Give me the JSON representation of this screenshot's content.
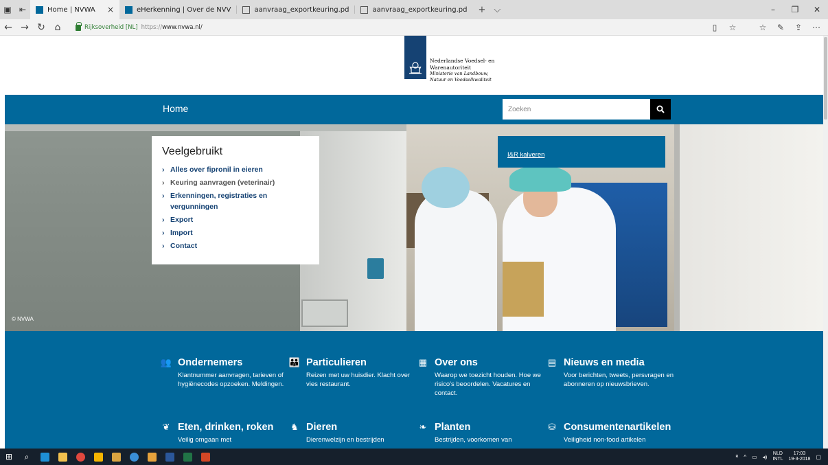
{
  "browser": {
    "tabs": [
      {
        "title": "Home | NVWA",
        "icon": "nvwa-favicon",
        "active": true
      },
      {
        "title": "eHerkenning | Over de NVV",
        "icon": "nvwa-favicon",
        "active": false
      },
      {
        "title": "aanvraag_exportkeuring.pd",
        "icon": "pdf-icon",
        "active": false
      },
      {
        "title": "aanvraag_exportkeuring.pd",
        "icon": "pdf-icon",
        "active": false
      }
    ],
    "address": {
      "org": "Rijksoverheid [NL]",
      "protocol": "https://",
      "host": "www.nvwa.nl/"
    }
  },
  "header": {
    "org_line1": "Nederlandse Voedsel- en",
    "org_line2": "Warenautoriteit",
    "ministry_line1": "Ministerie van Landbouw,",
    "ministry_line2": "Natuur en Voedselkwaliteit"
  },
  "nav": {
    "home": "Home",
    "search_placeholder": "Zoeken"
  },
  "hero": {
    "copyright": "© NVWA",
    "veelgebruikt": {
      "title": "Veelgebruikt",
      "items": [
        {
          "label": "Alles over fipronil in eieren"
        },
        {
          "label": "Keuring aanvragen (veterinair)"
        },
        {
          "label": "Erkenningen, registraties en vergunningen"
        },
        {
          "label": "Export"
        },
        {
          "label": "Import"
        },
        {
          "label": "Contact"
        }
      ]
    },
    "quicklink": "I&R kalveren"
  },
  "categories": [
    {
      "title": "Ondernemers",
      "icon": "people-icon",
      "desc": "Klantnummer aanvragen, tarieven of hygiënecodes opzoeken. Meldingen."
    },
    {
      "title": "Particulieren",
      "icon": "family-icon",
      "desc": "Reizen met uw huisdier. Klacht over vies restaurant."
    },
    {
      "title": "Over ons",
      "icon": "building-icon",
      "desc": "Waarop we toezicht houden. Hoe we risico's beoordelen. Vacatures en contact."
    },
    {
      "title": "Nieuws en media",
      "icon": "newspaper-icon",
      "desc": "Voor berichten, tweets, persvragen en abonneren op nieuwsbrieven."
    },
    {
      "title": "Eten, drinken, roken",
      "icon": "apple-icon",
      "desc": "Veilig omgaan met"
    },
    {
      "title": "Dieren",
      "icon": "cow-icon",
      "desc": "Dierenwelzijn en bestrijden"
    },
    {
      "title": "Planten",
      "icon": "plant-icon",
      "desc": "Bestrijden, voorkomen van"
    },
    {
      "title": "Consumentenartikelen",
      "icon": "products-icon",
      "desc": "Veiligheid non-food artikelen"
    }
  ],
  "taskbar": {
    "lang1": "NLD",
    "lang2": "INTL",
    "time": "17:03",
    "date": "19-3-2018"
  },
  "colors": {
    "brand_blue": "#01689b",
    "dark_blue": "#154273"
  }
}
